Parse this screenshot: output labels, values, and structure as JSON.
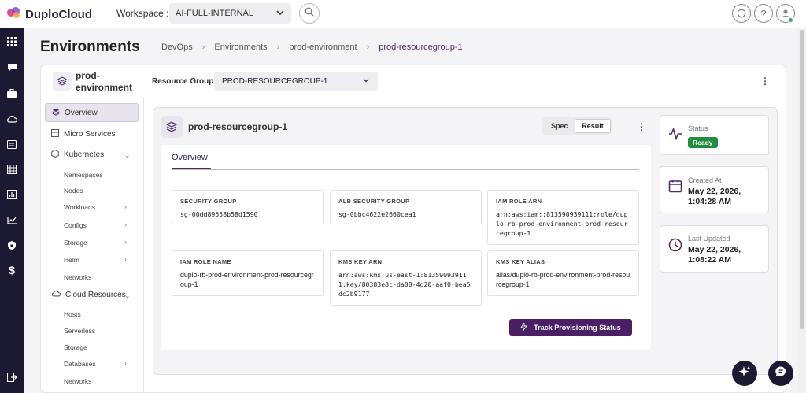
{
  "app": {
    "logo_text": "DuploCloud",
    "workspace_label": "Workspace :",
    "workspace_value": "AI-FULL-INTERNAL",
    "brand_color": "#4a1f66"
  },
  "header": {
    "page_title": "Environments",
    "breadcrumb": [
      "DevOps",
      "Environments",
      "prod-environment",
      "prod-resourcegroup-1"
    ]
  },
  "environment": {
    "name": "prod-environment",
    "resource_group_label": "Resource Group",
    "resource_group_value": "PROD-RESOURCEGROUP-1"
  },
  "subnav": {
    "overview": "Overview",
    "micro_services": "Micro Services",
    "kubernetes": "Kubernetes",
    "k8s_items": [
      "Namespaces",
      "Nodes",
      "Workloads",
      "Configs",
      "Storage",
      "Helm",
      "Networks"
    ],
    "cloud_resources": "Cloud Resources",
    "cloud_items": [
      "Hosts",
      "Serverless",
      "Storage",
      "Databases",
      "Networks"
    ]
  },
  "resource_group": {
    "name": "prod-resourcegroup-1",
    "toggle_spec": "Spec",
    "toggle_result": "Result",
    "tab_overview": "Overview",
    "fields": [
      {
        "label": "SECURITY GROUP",
        "value": "sg-00dd89558b58d1590"
      },
      {
        "label": "ALB SECURITY GROUP",
        "value": "sg-0bbc4622e2660cea1"
      },
      {
        "label": "IAM ROLE ARN",
        "value": "arn:aws:iam::813590939111:role/duplo-rb-prod-environment-prod-resourcegroup-1"
      },
      {
        "label": "IAM ROLE NAME",
        "value": "duplo-rb-prod-environment-prod-resourcegroup-1"
      },
      {
        "label": "KMS KEY ARN",
        "value": "arn:aws:kms:us-east-1:813590939111:key/80383e8c-da08-4d20-aaf0-bea5dc2b9177"
      },
      {
        "label": "KMS KEY ALIAS",
        "value": "alias/duplo-rb-prod-environment-prod-resourcegroup-1"
      }
    ],
    "track_button": "Track Provisioning Status"
  },
  "status_cards": {
    "status_label": "Status",
    "status_value": "Ready",
    "status_color": "#1e8e3e",
    "created_label": "Created At",
    "created_value": "May 22, 2026, 1:04:28 AM",
    "updated_label": "Last Updated",
    "updated_value": "May 22, 2026, 1:08:22 AM"
  },
  "icons": [
    "logo-icon",
    "chevron-down-icon",
    "search-icon",
    "shield-icon",
    "help-icon",
    "user-icon",
    "grid-icon",
    "chat-icon",
    "briefcase-icon",
    "cloud-icon",
    "list-icon",
    "table-icon",
    "report-icon",
    "chart-icon",
    "security-icon",
    "dollar-icon",
    "logout-icon",
    "layers-icon",
    "kebab-icon",
    "activity-icon",
    "calendar-icon",
    "clock-icon",
    "sparkle-icon",
    "support-chat-icon"
  ]
}
